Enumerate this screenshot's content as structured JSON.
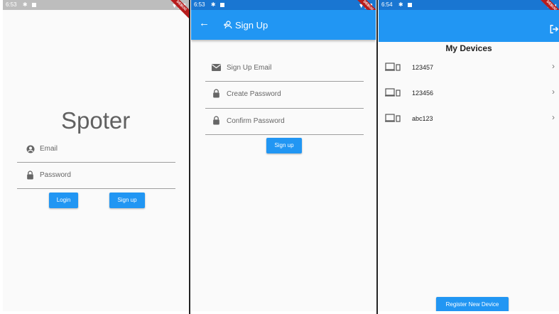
{
  "login": {
    "status_time": "6:53",
    "debug_ribbon": "DEBUG",
    "app_title": "Spoter",
    "email_placeholder": "Email",
    "password_placeholder": "Password",
    "login_label": "Login",
    "signup_label": "Sign up"
  },
  "signup": {
    "status_time": "6:53",
    "debug_ribbon": "DEBUG",
    "appbar_title": "Sign Up",
    "email_placeholder": "Sign Up Email",
    "create_password_placeholder": "Create Password",
    "confirm_password_placeholder": "Confirm Password",
    "signup_label": "Sign up"
  },
  "devices": {
    "status_time": "6:54",
    "debug_ribbon": "DEBUG",
    "header": "My Devices",
    "items": [
      {
        "name": "123457"
      },
      {
        "name": "123456"
      },
      {
        "name": "abc123"
      }
    ],
    "register_label": "Register New Device"
  },
  "colors": {
    "primary": "#2196f3",
    "statusbar_grey": "#bdbdbd",
    "statusbar_blue": "#1976d2"
  }
}
